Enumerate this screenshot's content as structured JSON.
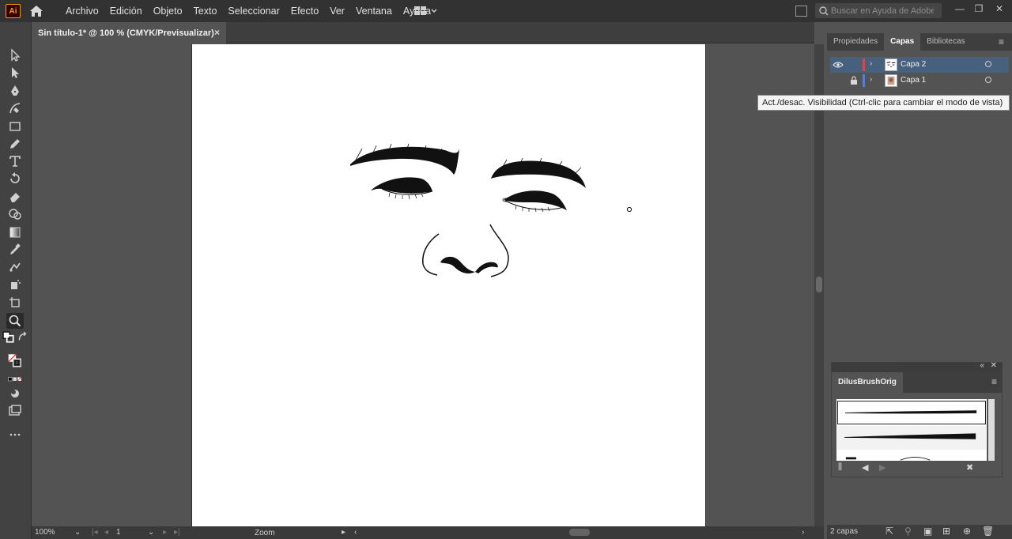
{
  "app": {
    "logo_text": "Ai"
  },
  "menu": [
    "Archivo",
    "Edición",
    "Objeto",
    "Texto",
    "Seleccionar",
    "Efecto",
    "Ver",
    "Ventana",
    "Ayuda"
  ],
  "search": {
    "placeholder": "Buscar en Ayuda de Adobe"
  },
  "document_tab": {
    "title": "Sin título-1* @ 100 % (CMYK/Previsualizar)",
    "close": "×"
  },
  "panels": {
    "tabs": [
      "Propiedades",
      "Capas",
      "Bibliotecas"
    ],
    "active_tab": "Capas",
    "layers": [
      {
        "name": "Capa 2",
        "selected": true,
        "color": "#e2453c",
        "locked": false
      },
      {
        "name": "Capa 1",
        "selected": false,
        "color": "#4f7fe0",
        "locked": true
      }
    ],
    "tooltip": "Act./desac. Visibilidad (Ctrl-clic para cambiar el modo de vista)",
    "layer_count": "2 capas"
  },
  "brush_panel": {
    "title": "DilusBrushOrig"
  },
  "status": {
    "zoom": "100%",
    "artboard": "1",
    "mode": "Zoom"
  },
  "colors": {
    "selected_layer": "#46607e",
    "accent_logo": "#ff9a00"
  }
}
